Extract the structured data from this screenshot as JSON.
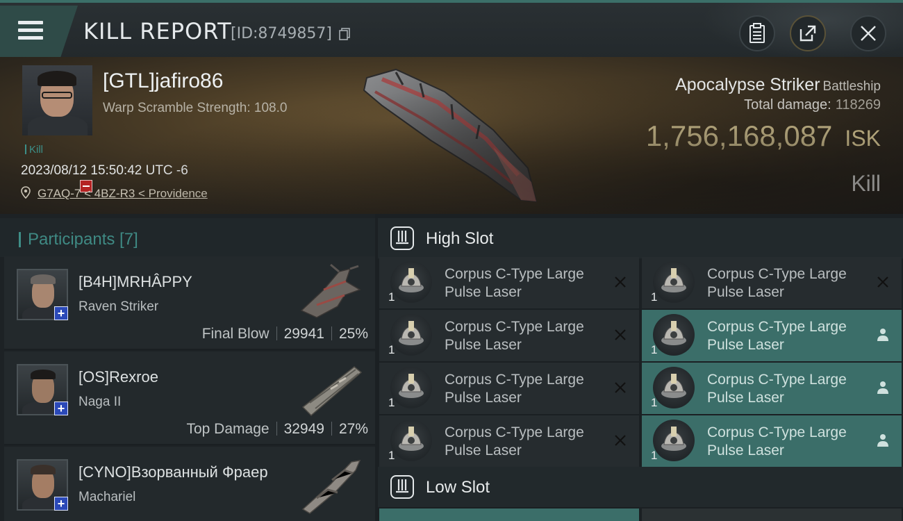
{
  "header": {
    "title": "KILL REPORT",
    "report_id": "[ID:8749857]"
  },
  "victim": {
    "name": "[GTL]jafiro86",
    "warp_scramble": "Warp Scramble Strength: 108.0",
    "tag": "Kill",
    "datetime": "2023/08/12 15:50:42 UTC -6",
    "location": "G7AQ-7 < 4BZ-R3 < Providence",
    "ship_name": "Apocalypse Striker",
    "ship_class": "Battleship",
    "total_damage_label": "Total damage:",
    "total_damage": "118269",
    "isk_value": "1,756,168,087",
    "isk_unit": "ISK",
    "result": "Kill"
  },
  "participants": {
    "title": "Participants [7]",
    "items": [
      {
        "name": "[B4H]MRHÂPPY",
        "ship": "Raven Striker",
        "label": "Final Blow",
        "damage": "29941",
        "percent": "25%"
      },
      {
        "name": "[OS]Rexroe",
        "ship": "Naga II",
        "label": "Top Damage",
        "damage": "32949",
        "percent": "27%"
      },
      {
        "name": "[CYNO]Взорванный Фраер",
        "ship": "Machariel",
        "label": "",
        "damage": "",
        "percent": ""
      }
    ]
  },
  "slots": {
    "high_title": "High Slot",
    "low_title": "Low Slot",
    "high_modules": [
      {
        "qty": "1",
        "name": "Corpus C-Type Large Pulse Laser",
        "state": "destroyed"
      },
      {
        "qty": "1",
        "name": "Corpus C-Type Large Pulse Laser",
        "state": "destroyed"
      },
      {
        "qty": "1",
        "name": "Corpus C-Type Large Pulse Laser",
        "state": "destroyed"
      },
      {
        "qty": "1",
        "name": "Corpus C-Type Large Pulse Laser",
        "state": "dropped"
      },
      {
        "qty": "1",
        "name": "Corpus C-Type Large Pulse Laser",
        "state": "destroyed"
      },
      {
        "qty": "1",
        "name": "Corpus C-Type Large Pulse Laser",
        "state": "dropped"
      },
      {
        "qty": "1",
        "name": "Corpus C-Type Large Pulse Laser",
        "state": "destroyed"
      },
      {
        "qty": "1",
        "name": "Corpus C-Type Large Pulse Laser",
        "state": "dropped"
      }
    ]
  },
  "colors": {
    "accent_teal": "#3b6e69",
    "isk_gold": "#e9d7a0",
    "badge_red": "#b52323",
    "badge_blue": "#2b49b8"
  },
  "icons": {
    "menu": "hamburger-icon",
    "copy": "copy-icon",
    "clipboard": "clipboard-icon",
    "share": "share-icon",
    "close": "close-icon",
    "location": "map-pin-icon",
    "slot": "high-slot-icon",
    "destroyed": "x-icon",
    "dropped": "person-icon"
  }
}
